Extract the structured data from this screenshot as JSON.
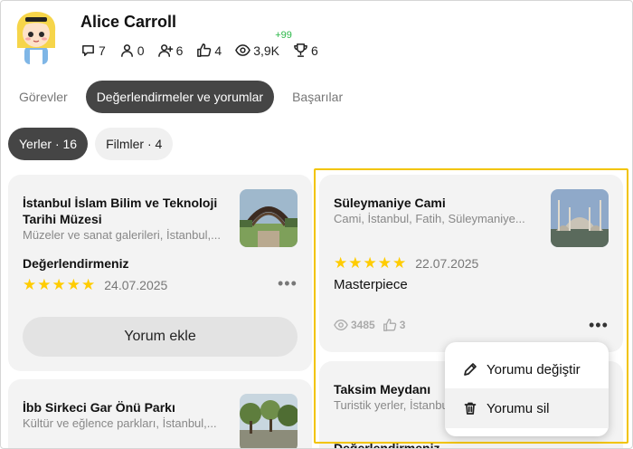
{
  "user": {
    "name": "Alice Carroll",
    "stats": [
      {
        "icon": "comment-icon",
        "value": "7"
      },
      {
        "icon": "person-icon",
        "value": "0"
      },
      {
        "icon": "follow-icon",
        "value": "6"
      },
      {
        "icon": "thumbs-up-icon",
        "value": "4"
      },
      {
        "icon": "eye-icon",
        "value": "3,9K",
        "delta": "+99"
      },
      {
        "icon": "trophy-icon",
        "value": "6"
      }
    ]
  },
  "tabs": [
    {
      "label": "Görevler",
      "active": false
    },
    {
      "label": "Değerlendirmeler ve yorumlar",
      "active": true
    },
    {
      "label": "Başarılar",
      "active": false
    }
  ],
  "filters": [
    {
      "label": "Yerler · 16",
      "active": true
    },
    {
      "label": "Filmler · 4",
      "active": false
    }
  ],
  "cards": {
    "museum": {
      "title": "İstanbul İslam Bilim ve Teknoloji Tarihi Müzesi",
      "subtitle": "Müzeler ve sanat galerileri, İstanbul,...",
      "your_rating_label": "Değerlendirmeniz",
      "stars": 5,
      "date": "24.07.2025",
      "add_comment": "Yorum ekle"
    },
    "suleymaniye": {
      "title": "Süleymaniye Cami",
      "subtitle": "Cami, İstanbul, Fatih, Süleymaniye...",
      "stars": 5,
      "date": "22.07.2025",
      "review": "Masterpiece",
      "views": "3485",
      "likes": "3"
    },
    "sirkeci": {
      "title": "İbb Sirkeci Gar Önü Parkı",
      "subtitle": "Kültür ve eğlence parkları, İstanbul,..."
    },
    "taksim": {
      "title": "Taksim Meydanı",
      "subtitle": "Turistik yerler, İstanbul",
      "your_rating_label": "Değerlendirmeniz"
    }
  },
  "context_menu": {
    "edit": "Yorumu değiştir",
    "delete": "Yorumu sil"
  },
  "colors": {
    "active_tab": "#454545",
    "star": "#ffcc00",
    "delta": "#2db84a",
    "highlight": "#f2c400"
  }
}
